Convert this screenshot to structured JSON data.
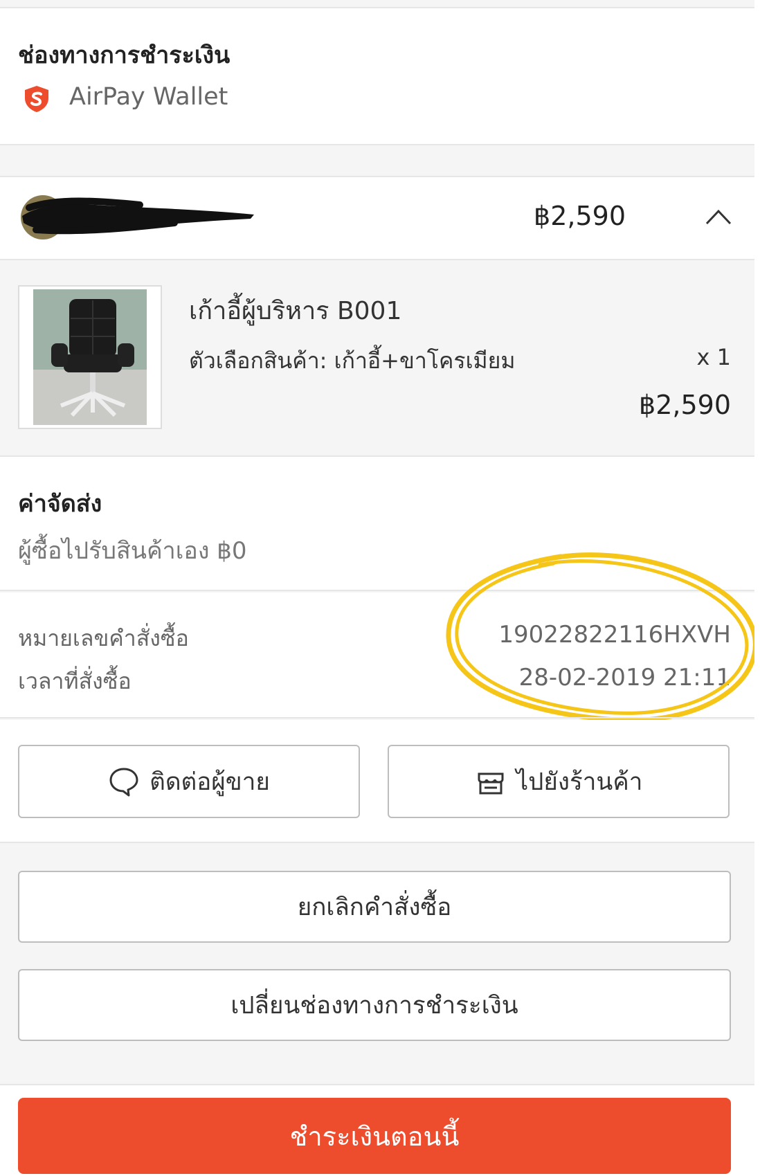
{
  "payment": {
    "title": "ช่องทางการชำระเงิน",
    "method_icon": "airpay-shield-icon",
    "method_name": "AirPay Wallet"
  },
  "shop": {
    "name_redacted": true,
    "total": "฿2,590",
    "toggle_icon": "chevron-up-icon"
  },
  "product": {
    "image": "office-chair-photo",
    "name": "เก้าอี้ผู้บริหาร B001",
    "variant": "ตัวเลือกสินค้า: เก้าอี้+ขาโครเมียม",
    "quantity": "x 1",
    "price": "฿2,590"
  },
  "shipping": {
    "title": "ค่าจัดส่ง",
    "value": "ผู้ซื้อไปรับสินค้าเอง ฿0"
  },
  "order": {
    "number_label": "หมายเลขคำสั่งซื้อ",
    "number_value": "19022822116HXVH",
    "time_label": "เวลาที่สั่งซื้อ",
    "time_value": "28-02-2019 21:11",
    "highlight_color": "#f5c518"
  },
  "actions": {
    "chat_icon": "chat-bubble-icon",
    "chat_label": "ติดต่อผู้ขาย",
    "shop_icon": "storefront-icon",
    "shop_label": "ไปยังร้านค้า",
    "cancel_label": "ยกเลิกคำสั่งซื้อ",
    "change_payment_label": "เปลี่ยนช่องทางการชำระเงิน",
    "pay_now_label": "ชำระเงินตอนนี้",
    "accent_color": "#ee4d2d"
  }
}
